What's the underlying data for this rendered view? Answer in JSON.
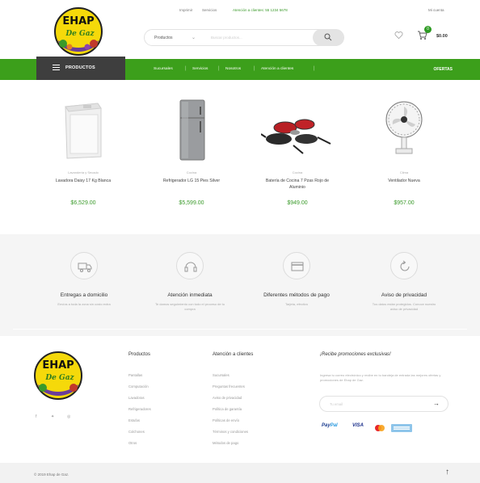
{
  "topbar": {
    "links": [
      "Imprimir",
      "Servicios"
    ],
    "phone_text": "Atención a clientes: 55 1234 5678",
    "language": "Mi cuenta"
  },
  "brand": {
    "logo_text": "EHAP",
    "logo_sub": "De Gaz"
  },
  "search": {
    "category": "Productos",
    "placeholder": "Buscar productos..."
  },
  "cart": {
    "count": "0",
    "total": "$0.00"
  },
  "nav": {
    "products_label": "PRODUCTOS",
    "links": [
      "Sucursales",
      "Servicios",
      "Nosotros",
      "Atención a clientes"
    ],
    "offers_label": "OFERTAS"
  },
  "products": [
    {
      "category": "Lavandería y Secado",
      "name": "Lavadora Daisy 17 Kg Blanca",
      "price": "$6,529.00"
    },
    {
      "category": "Cocina",
      "name": "Refrigerador LG 15 Pies Silver",
      "price": "$5,599.00"
    },
    {
      "category": "Cocina",
      "name": "Batería de Cocina 7 Pzas Rojo de Aluminio",
      "price": "$949.00"
    },
    {
      "category": "Clima",
      "name": "Ventilador Nueva",
      "price": "$957.00"
    }
  ],
  "features": [
    {
      "title": "Entregas a domicilio",
      "desc": "Envíos a toda la zona sin costo extra"
    },
    {
      "title": "Atención inmediata",
      "desc": "Te damos seguimiento con todo el proceso de tu compra"
    },
    {
      "title": "Diferentes métodos de pago",
      "desc": "Tarjeta, efectivo"
    },
    {
      "title": "Aviso de privacidad",
      "desc": "Tus datos están protegidos. Conoce nuestro aviso de privacidad"
    }
  ],
  "footer": {
    "col1_title": "Productos",
    "col1_items": [
      "Pantallas",
      "Computación",
      "Lavadoras",
      "Refrigeradores",
      "Estufas",
      "Colchones",
      "Otros"
    ],
    "col2_title": "Atención a clientes",
    "col2_items": [
      "Sucursales",
      "Preguntas frecuentes",
      "Aviso de privacidad",
      "Política de garantía",
      "Políticas de envío",
      "Términos y condiciones",
      "Métodos de pago"
    ],
    "promo_title": "¡Recibe promociones exclusivas!",
    "promo_text": "Ingresa tu correo electrónico y recibe en tu bandeja de entrada las mejores ofertas y promociones de Ehap de Gaz.",
    "email_placeholder": "Tu email",
    "email_submit": "→",
    "payments": {
      "paypal_a": "Pay",
      "paypal_b": "Pal",
      "visa": "VISA"
    },
    "copyright": "© 2019 Ehap de Gaz.",
    "back_to_top": "↑"
  },
  "colors": {
    "brand_green": "#3c9f1b",
    "dark": "#3e3e3e",
    "price_green": "#3a9a2a"
  }
}
